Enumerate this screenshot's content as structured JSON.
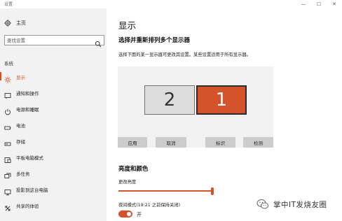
{
  "window": {
    "title": "设置",
    "minimize_glyph": "—",
    "maximize_glyph": "☐",
    "close_glyph": "✕"
  },
  "sidebar": {
    "home_label": "主页",
    "search_placeholder": "查找设置",
    "section_label": "系统",
    "items": [
      {
        "label": "显示",
        "icon": "display-icon",
        "active": true
      },
      {
        "label": "通知和操作",
        "icon": "notification-icon"
      },
      {
        "label": "电源和睡眠",
        "icon": "power-icon"
      },
      {
        "label": "电池",
        "icon": "battery-icon"
      },
      {
        "label": "存储",
        "icon": "storage-icon"
      },
      {
        "label": "平板电脑模式",
        "icon": "tablet-icon"
      },
      {
        "label": "多任务",
        "icon": "multitask-icon"
      },
      {
        "label": "投影到这台电脑",
        "icon": "project-icon"
      },
      {
        "label": "共享的体验",
        "icon": "shared-icon"
      }
    ]
  },
  "main": {
    "page_title": "显示",
    "arrange_title": "选择并重新排列多个显示器",
    "arrange_desc": "选择下面的某一显示器可更改其设置。某些设置适用于所有显示器。",
    "monitors": [
      {
        "number": "2",
        "selected": false
      },
      {
        "number": "1",
        "selected": true
      }
    ],
    "buttons": {
      "apply": "应用",
      "cancel": "取消",
      "identify": "标识",
      "detect": "检测"
    },
    "brightness_section": "亮度和颜色",
    "brightness_label": "更改亮度",
    "brightness_value": 1.0,
    "night_light_label": "夜间模式(19:21 之前保持关闭)",
    "night_light_state": "开",
    "night_light_on": true
  },
  "watermark": {
    "text": "掌中IT发烧友圈"
  },
  "colors": {
    "accent": "#d5532b",
    "sidebar_bg": "#f2f2f2",
    "display_area_bg": "#f2f2f2",
    "button_bg": "#cccccc"
  }
}
